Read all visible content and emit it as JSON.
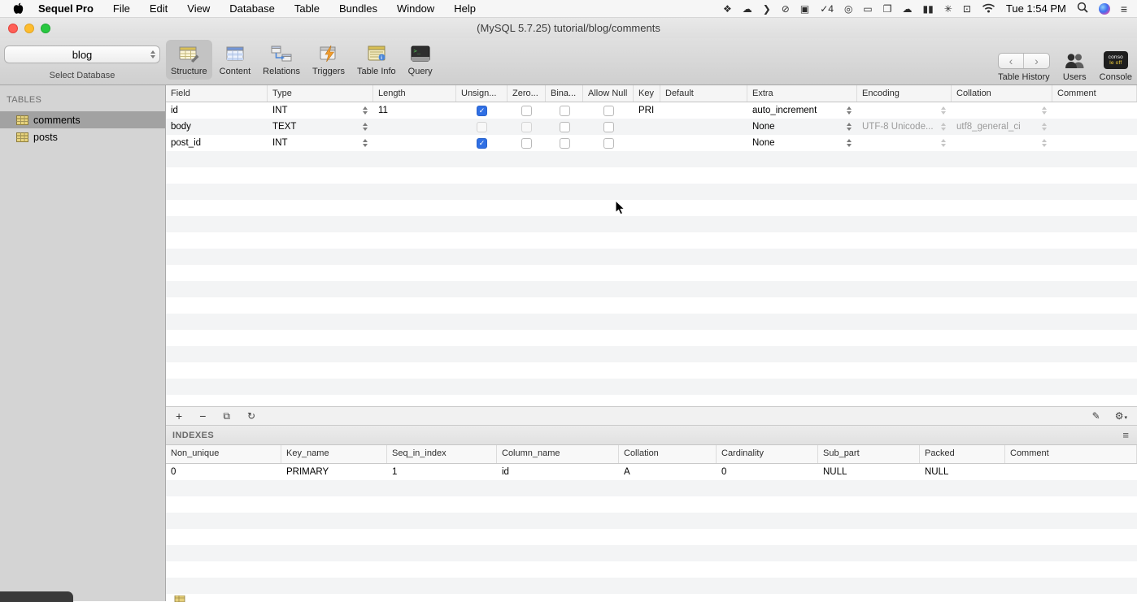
{
  "menu_bar": {
    "app_name": "Sequel Pro",
    "menus": [
      "File",
      "Edit",
      "View",
      "Database",
      "Table",
      "Bundles",
      "Window",
      "Help"
    ],
    "status_icons": [
      {
        "name": "dropbox-icon",
        "glyph": "❖"
      },
      {
        "name": "cloud-icon",
        "glyph": "☁"
      },
      {
        "name": "chevron-icon",
        "glyph": "❯"
      },
      {
        "name": "do-not-disturb-icon",
        "glyph": "⊘"
      },
      {
        "name": "screen-record-icon",
        "glyph": "▣"
      },
      {
        "name": "updates-badge-icon",
        "glyph": "✓4"
      },
      {
        "name": "at-circle-icon",
        "glyph": "◎"
      },
      {
        "name": "display-icon",
        "glyph": "▭"
      },
      {
        "name": "window-icon",
        "glyph": "❐"
      },
      {
        "name": "cloud-filled-icon",
        "glyph": "☁"
      },
      {
        "name": "stats-bars-icon",
        "glyph": "▮▮"
      },
      {
        "name": "fan-icon",
        "glyph": "✳"
      },
      {
        "name": "airplay-icon",
        "glyph": "⊡"
      }
    ],
    "clock": "Tue 1:54 PM"
  },
  "window": {
    "title": "(MySQL 5.7.25) tutorial/blog/comments"
  },
  "toolbar": {
    "database_select": {
      "value": "blog",
      "caption": "Select Database"
    },
    "tabs": [
      {
        "label": "Structure",
        "active": true
      },
      {
        "label": "Content",
        "active": false
      },
      {
        "label": "Relations",
        "active": false
      },
      {
        "label": "Triggers",
        "active": false
      },
      {
        "label": "Table Info",
        "active": false
      },
      {
        "label": "Query",
        "active": false
      }
    ],
    "history_back": "‹",
    "history_forward": "›",
    "table_history_label": "Table History",
    "users_label": "Users",
    "console_label": "Console",
    "console_badge": [
      "conso",
      "le off"
    ]
  },
  "sidebar": {
    "header": "TABLES",
    "tables": [
      {
        "name": "comments",
        "selected": true
      },
      {
        "name": "posts",
        "selected": false
      }
    ]
  },
  "structure": {
    "columns": [
      "Field",
      "Type",
      "Length",
      "Unsign...",
      "Zero...",
      "Bina...",
      "Allow Null",
      "Key",
      "Default",
      "Extra",
      "Encoding",
      "Collation",
      "Comment"
    ],
    "rows": [
      {
        "field": "id",
        "type": "INT",
        "length": "11",
        "unsigned": "checked",
        "zerofill": "unchecked",
        "binary": "unchecked",
        "allow_null": "unchecked",
        "key": "PRI",
        "default": "",
        "extra": "auto_increment",
        "encoding": "",
        "collation": "",
        "comment": ""
      },
      {
        "field": "body",
        "type": "TEXT",
        "length": "",
        "unsigned": "disabled",
        "zerofill": "disabled",
        "binary": "unchecked",
        "allow_null": "unchecked",
        "key": "",
        "default": "",
        "extra": "None",
        "encoding": "UTF-8 Unicode...",
        "collation": "utf8_general_ci",
        "comment": ""
      },
      {
        "field": "post_id",
        "type": "INT",
        "length": "",
        "unsigned": "checked",
        "zerofill": "unchecked",
        "binary": "unchecked",
        "allow_null": "unchecked",
        "key": "",
        "default": "",
        "extra": "None",
        "encoding": "",
        "collation": "",
        "comment": ""
      }
    ]
  },
  "structure_toolbar": {
    "add": "+",
    "remove": "−",
    "duplicate": "⧉",
    "refresh": "↻",
    "edit": "✎",
    "settings": "⚙",
    "settings_caret": "▾"
  },
  "indexes": {
    "title": "INDEXES",
    "menu_glyph": "≡",
    "columns": [
      "Non_unique",
      "Key_name",
      "Seq_in_index",
      "Column_name",
      "Collation",
      "Cardinality",
      "Sub_part",
      "Packed",
      "Comment"
    ],
    "rows": [
      [
        "0",
        "PRIMARY",
        "1",
        "id",
        "A",
        "0",
        "NULL",
        "NULL",
        ""
      ]
    ]
  }
}
